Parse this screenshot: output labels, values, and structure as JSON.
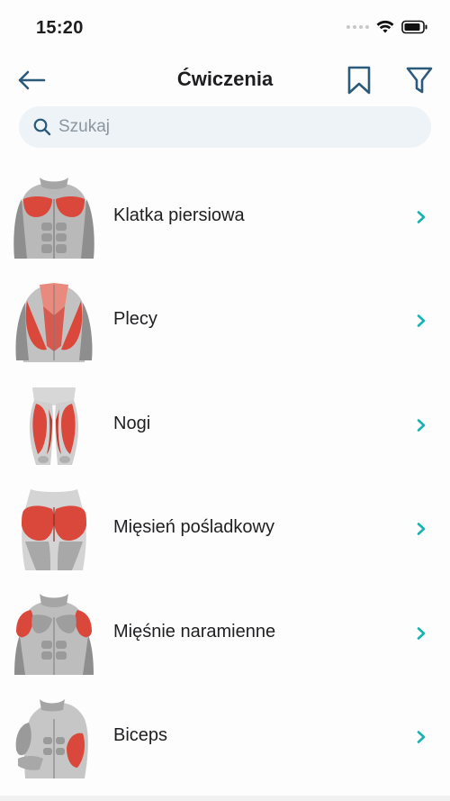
{
  "status": {
    "time": "15:20"
  },
  "header": {
    "title": "Ćwiczenia"
  },
  "search": {
    "placeholder": "Szukaj",
    "value": ""
  },
  "items": [
    {
      "label": "Klatka piersiowa",
      "icon": "chest-muscle-image"
    },
    {
      "label": "Plecy",
      "icon": "back-muscle-image"
    },
    {
      "label": "Nogi",
      "icon": "legs-muscle-image"
    },
    {
      "label": "Mięsień pośladkowy",
      "icon": "glutes-muscle-image"
    },
    {
      "label": "Mięśnie naramienne",
      "icon": "shoulders-muscle-image"
    },
    {
      "label": "Biceps",
      "icon": "biceps-muscle-image"
    }
  ],
  "colors": {
    "accent": "#16b3b3",
    "icon": "#2b5a7a",
    "muscle": "#d9483b",
    "search_bg": "#eef3f7"
  }
}
